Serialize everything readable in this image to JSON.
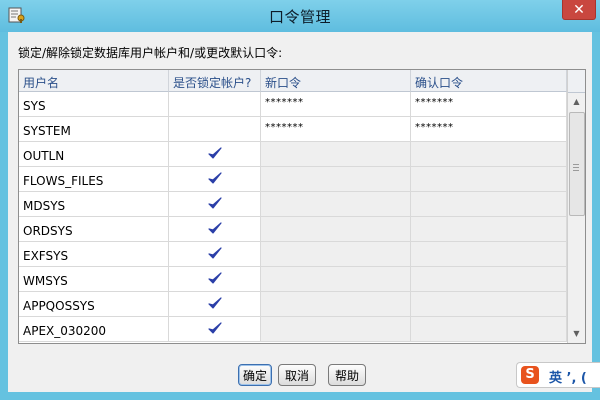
{
  "window": {
    "title": "口令管理",
    "close_label": "✕",
    "icon": "app-key-icon"
  },
  "instructions": "锁定/解除锁定数据库用户帐户和/或更改默认口令:",
  "table": {
    "headers": [
      "用户名",
      "是否锁定帐户?",
      "新口令",
      "确认口令"
    ],
    "rows": [
      {
        "username": "SYS",
        "locked": false,
        "new_password": "*******",
        "confirm_password": "*******"
      },
      {
        "username": "SYSTEM",
        "locked": false,
        "new_password": "*******",
        "confirm_password": "*******"
      },
      {
        "username": "OUTLN",
        "locked": true,
        "new_password": "",
        "confirm_password": ""
      },
      {
        "username": "FLOWS_FILES",
        "locked": true,
        "new_password": "",
        "confirm_password": ""
      },
      {
        "username": "MDSYS",
        "locked": true,
        "new_password": "",
        "confirm_password": ""
      },
      {
        "username": "ORDSYS",
        "locked": true,
        "new_password": "",
        "confirm_password": ""
      },
      {
        "username": "EXFSYS",
        "locked": true,
        "new_password": "",
        "confirm_password": ""
      },
      {
        "username": "WMSYS",
        "locked": true,
        "new_password": "",
        "confirm_password": ""
      },
      {
        "username": "APPQOSSYS",
        "locked": true,
        "new_password": "",
        "confirm_password": ""
      },
      {
        "username": "APEX_030200",
        "locked": true,
        "new_password": "",
        "confirm_password": ""
      }
    ],
    "check_icon": "checkmark-icon",
    "check_color": "#2b3fa8"
  },
  "scrollbar": {
    "up_icon": "▲",
    "down_icon": "▼"
  },
  "buttons": {
    "ok": "确定",
    "cancel": "取消",
    "help": "帮助"
  },
  "ime": {
    "logo": "S",
    "text": "英 ’, ("
  }
}
